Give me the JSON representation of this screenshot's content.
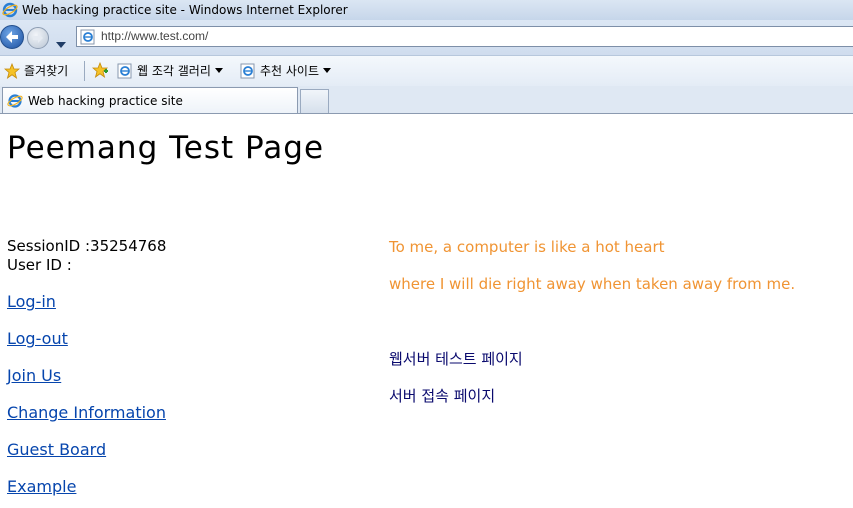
{
  "window": {
    "title": "Web hacking practice site - Windows Internet Explorer",
    "icon": "ie-icon"
  },
  "address_bar": {
    "url": "http://www.test.com/"
  },
  "favorites_bar": {
    "favorites_label": "즐겨찾기",
    "items": [
      {
        "label": "웹 조각 갤러리",
        "icon": "ie-page-icon"
      },
      {
        "label": "추천 사이트",
        "icon": "ie-page-icon"
      }
    ]
  },
  "tabs": [
    {
      "label": "Web hacking practice site",
      "active": true
    }
  ],
  "page": {
    "title": "Peemang Test Page",
    "session_label": "SessionID :",
    "session_value": "35254768",
    "userid_label": "User ID :",
    "userid_value": "",
    "links": [
      {
        "label": "Log-in"
      },
      {
        "label": "Log-out"
      },
      {
        "label": "Join Us"
      },
      {
        "label": "Change Information"
      },
      {
        "label": "Guest Board"
      },
      {
        "label": "Example"
      }
    ],
    "quote": [
      "To me, a computer is like a hot heart",
      "where I will die right away when taken away from me."
    ],
    "server_links": [
      {
        "label": "웹서버 테스트 페이지"
      },
      {
        "label": "서버 접속 페이지"
      }
    ]
  },
  "colors": {
    "link": "#0645ad",
    "quote": "#f09433",
    "server_link": "#0a0a6e"
  }
}
